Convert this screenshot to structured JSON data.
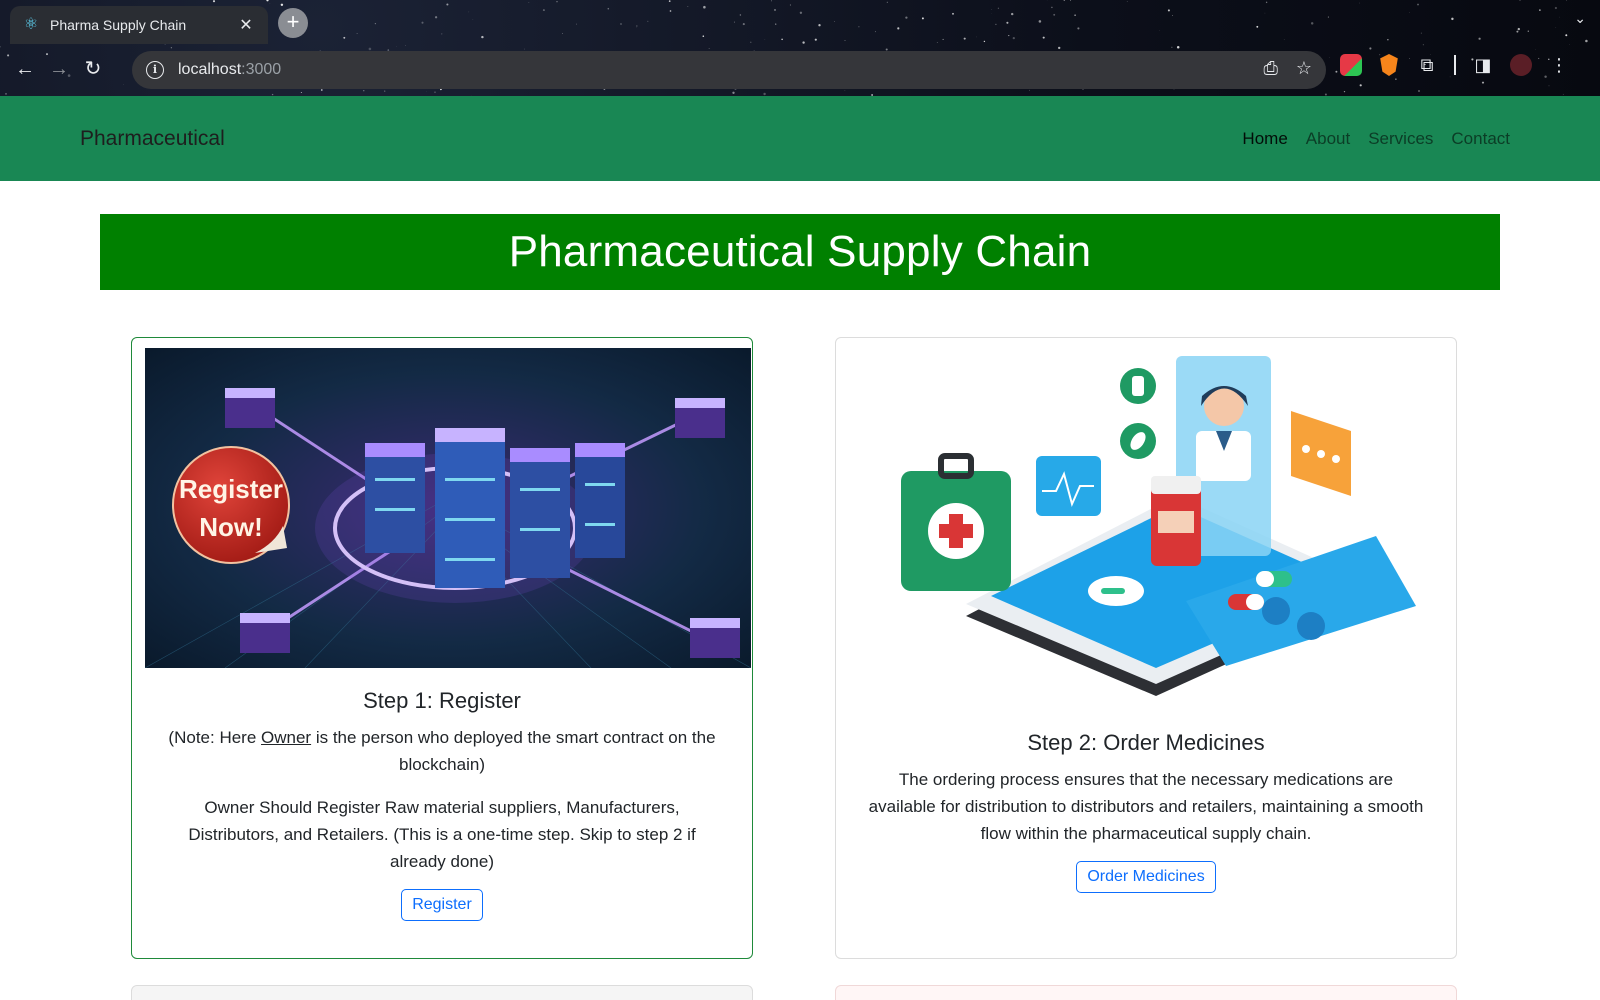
{
  "browser": {
    "tab_title": "Pharma Supply Chain",
    "tab_favicon": "react-atom-icon",
    "close_glyph": "✕",
    "newtab_glyph": "+",
    "url_host": "localhost",
    "url_port": ":3000"
  },
  "navbar": {
    "brand": "Pharmaceutical",
    "links": [
      {
        "label": "Home",
        "active": true
      },
      {
        "label": "About",
        "active": false
      },
      {
        "label": "Services",
        "active": false
      },
      {
        "label": "Contact",
        "active": false
      }
    ],
    "color": "#198754"
  },
  "hero": {
    "title": "Pharmaceutical Supply Chain",
    "color": "#008000"
  },
  "cards": [
    {
      "image_badge_line1": "Register",
      "image_badge_line2": "Now!",
      "title": "Step 1: Register",
      "note_prefix": "(Note: Here ",
      "note_link": "Owner",
      "note_suffix": " is the person who deployed the smart contract on the blockchain)",
      "text": "Owner Should Register Raw material suppliers, Manufacturers, Distributors, and Retailers. (This is a one-time step. Skip to step 2 if already done)",
      "button": "Register"
    },
    {
      "title": "Step 2: Order Medicines",
      "text": "The ordering process ensures that the necessary medications are available for distribution to distributors and retailers, maintaining a smooth flow within the pharmaceutical supply chain.",
      "button": "Order Medicines"
    }
  ],
  "colors": {
    "button_outline": "#0d6efd",
    "card1_border": "#1f8a3a"
  }
}
